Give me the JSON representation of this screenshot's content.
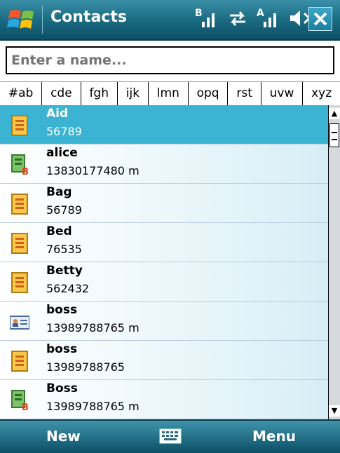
{
  "app": {
    "title": "Contacts"
  },
  "status": {
    "icons": [
      "signal-b-icon",
      "sync-arrows-icon",
      "signal-a-icon",
      "speaker-icon"
    ]
  },
  "search": {
    "placeholder": "Enter a name..."
  },
  "alpha_tabs": [
    "#ab",
    "cde",
    "fgh",
    "ijk",
    "lmn",
    "opq",
    "rst",
    "uvw",
    "xyz"
  ],
  "contacts": [
    {
      "name": "Aid",
      "number": "56789",
      "icon": "contact-card-icon",
      "selected": true
    },
    {
      "name": "alice",
      "number": "13830177480  m",
      "icon": "sim-contact-icon",
      "selected": false
    },
    {
      "name": "Bag",
      "number": "56789",
      "icon": "contact-card-icon",
      "selected": false
    },
    {
      "name": "Bed",
      "number": "76535",
      "icon": "contact-card-icon",
      "selected": false
    },
    {
      "name": "Betty",
      "number": "562432",
      "icon": "contact-card-icon",
      "selected": false
    },
    {
      "name": "boss",
      "number": "13989788765  m",
      "icon": "business-card-icon",
      "selected": false
    },
    {
      "name": "boss",
      "number": "13989788765",
      "icon": "contact-card-icon",
      "selected": false
    },
    {
      "name": "Boss",
      "number": "13989788765  m",
      "icon": "sim-contact-icon",
      "selected": false
    }
  ],
  "softkeys": {
    "left": "New",
    "right": "Menu"
  },
  "colors": {
    "titlebar": "#1d6f86",
    "selection": "#3ab4d2",
    "accent": "#0b4f66"
  }
}
